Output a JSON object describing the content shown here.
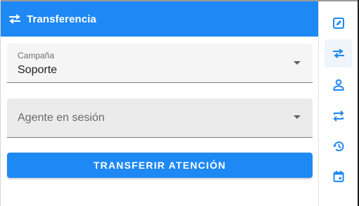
{
  "colors": {
    "accent": "#1e88f5",
    "field_bg": "#f5f5f5",
    "sidebar_icon": "#1e88f5"
  },
  "header": {
    "icon": "swap-horizontal-icon",
    "title": "Transferencia"
  },
  "form": {
    "campaign": {
      "label": "Campaña",
      "value": "Soporte"
    },
    "agent": {
      "placeholder": "Agente en sesión",
      "value": ""
    },
    "submit_label": "TRANSFERIR ATENCIÓN"
  },
  "sidebar": {
    "items": [
      {
        "icon": "edit-icon",
        "active": false
      },
      {
        "icon": "swap-horizontal-icon",
        "active": true
      },
      {
        "icon": "person-icon",
        "active": false
      },
      {
        "icon": "repeat-arrows-icon",
        "active": false
      },
      {
        "icon": "history-icon",
        "active": false
      },
      {
        "icon": "calendar-icon",
        "active": false
      }
    ]
  }
}
